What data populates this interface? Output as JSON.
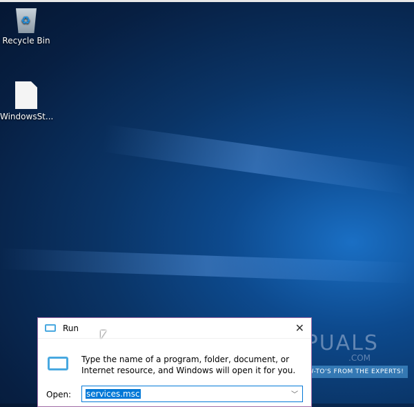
{
  "desktop": {
    "icons": [
      {
        "label": "Recycle Bin",
        "icon": "recycle-bin-icon"
      },
      {
        "label": "WindowsSt...",
        "icon": "file-icon"
      }
    ]
  },
  "run_dialog": {
    "title": "Run",
    "description": "Type the name of a program, folder, document, or Internet resource, and Windows will open it for you.",
    "open_label": "Open:",
    "open_value": "services.msc",
    "close": "✕"
  },
  "watermark": {
    "brand": "APPUALS",
    "domain": ".COM",
    "tagline": "TECH HOW-TO'S FROM THE EXPERTS!"
  }
}
